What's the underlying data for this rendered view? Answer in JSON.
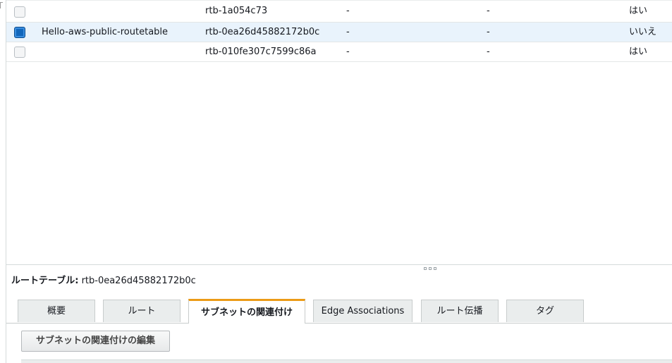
{
  "table": {
    "rows": [
      {
        "name": "",
        "id": "rtb-1a054c73",
        "col3": "-",
        "col4": "-",
        "main": "はい",
        "selected": false
      },
      {
        "name": "Hello-aws-public-routetable",
        "id": "rtb-0ea26d45882172b0c",
        "col3": "-",
        "col4": "-",
        "main": "いいえ",
        "selected": true
      },
      {
        "name": "",
        "id": "rtb-010fe307c7599c86a",
        "col3": "-",
        "col4": "-",
        "main": "はい",
        "selected": false
      }
    ]
  },
  "detail": {
    "label": "ルートテーブル:",
    "value": "rtb-0ea26d45882172b0c"
  },
  "tabs": [
    {
      "label": "概要"
    },
    {
      "label": "ルート"
    },
    {
      "label": "サブネットの関連付け"
    },
    {
      "label": "Edge Associations"
    },
    {
      "label": "ルート伝播"
    },
    {
      "label": "タグ"
    }
  ],
  "active_tab": "サブネットの関連付け",
  "action_button_label": "サブネットの関連付けの編集",
  "colors": {
    "selected_row": "#e9f3fc",
    "checkbox_checked": "#1166bb",
    "active_tab_accent": "#ec9b17"
  }
}
